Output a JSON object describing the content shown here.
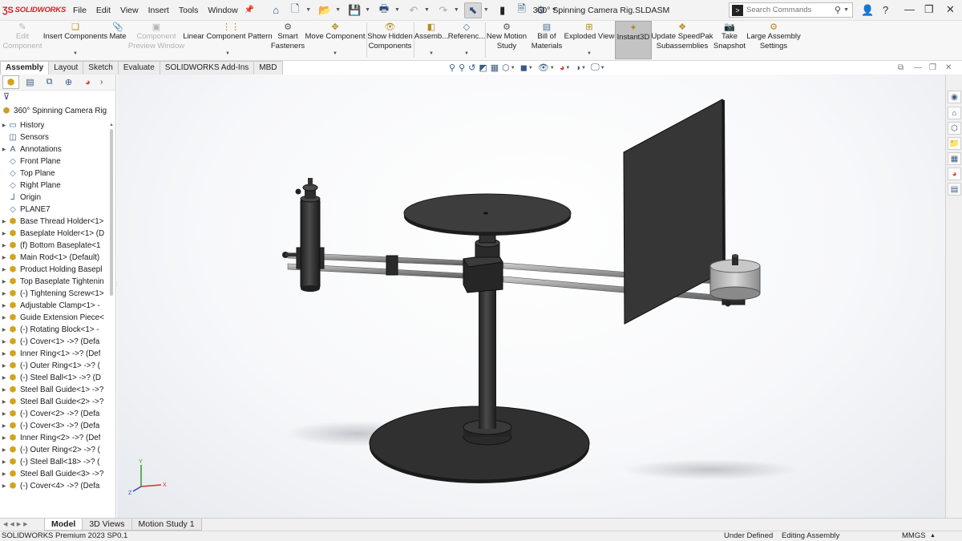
{
  "app": {
    "brand": "SOLIDWORKS",
    "menus": [
      "File",
      "Edit",
      "View",
      "Insert",
      "Tools",
      "Window"
    ],
    "document_title": "360° Spinning Camera Rig.SLDASM",
    "search_placeholder": "Search Commands"
  },
  "command_manager": {
    "commands": [
      {
        "label1": "Edit",
        "label2": "Component",
        "icon": "edit-component-icon",
        "enabled": false
      },
      {
        "label1": "Insert Components",
        "label2": "",
        "icon": "insert-components-icon",
        "enabled": true
      },
      {
        "label1": "Mate",
        "label2": "",
        "icon": "mate-icon",
        "enabled": true
      },
      {
        "label1": "Component",
        "label2": "Preview Window",
        "icon": "component-preview-icon",
        "enabled": false
      },
      {
        "label1": "Linear Component Pattern",
        "label2": "",
        "icon": "linear-pattern-icon",
        "enabled": true
      },
      {
        "label1": "Smart",
        "label2": "Fasteners",
        "icon": "smart-fasteners-icon",
        "enabled": true
      },
      {
        "label1": "Move Component",
        "label2": "",
        "icon": "move-component-icon",
        "enabled": true
      },
      {
        "label1": "Show Hidden",
        "label2": "Components",
        "icon": "show-hidden-icon",
        "enabled": true
      },
      {
        "label1": "Assemb...",
        "label2": "",
        "icon": "assembly-features-icon",
        "enabled": true
      },
      {
        "label1": "Referenc...",
        "label2": "",
        "icon": "reference-geometry-icon",
        "enabled": true
      },
      {
        "label1": "New Motion",
        "label2": "Study",
        "icon": "motion-study-icon",
        "enabled": true
      },
      {
        "label1": "Bill of",
        "label2": "Materials",
        "icon": "bom-icon",
        "enabled": true
      },
      {
        "label1": "Exploded View",
        "label2": "",
        "icon": "exploded-view-icon",
        "enabled": true
      },
      {
        "label1": "Instant3D",
        "label2": "",
        "icon": "instant3d-icon",
        "enabled": true
      },
      {
        "label1": "Update SpeedPak",
        "label2": "Subassemblies",
        "icon": "speedpak-icon",
        "enabled": true
      },
      {
        "label1": "Take",
        "label2": "Snapshot",
        "icon": "snapshot-icon",
        "enabled": true
      },
      {
        "label1": "Large Assembly",
        "label2": "Settings",
        "icon": "large-assembly-icon",
        "enabled": true
      }
    ]
  },
  "tabs": [
    "Assembly",
    "Layout",
    "Sketch",
    "Evaluate",
    "SOLIDWORKS Add-Ins",
    "MBD"
  ],
  "active_tab": "Assembly",
  "feature_tree": {
    "root": "360° Spinning Camera Rig (",
    "items": [
      {
        "label": "History",
        "icon": "folder-icon",
        "expandable": true
      },
      {
        "label": "Sensors",
        "icon": "sensor-icon",
        "expandable": false
      },
      {
        "label": "Annotations",
        "icon": "annotation-icon",
        "expandable": true
      },
      {
        "label": "Front Plane",
        "icon": "plane-icon",
        "expandable": false
      },
      {
        "label": "Top Plane",
        "icon": "plane-icon",
        "expandable": false
      },
      {
        "label": "Right Plane",
        "icon": "plane-icon",
        "expandable": false
      },
      {
        "label": "Origin",
        "icon": "origin-icon",
        "expandable": false
      },
      {
        "label": "PLANE7",
        "icon": "plane-icon",
        "expandable": false
      },
      {
        "label": "Base Thread Holder<1>",
        "icon": "component-icon",
        "expandable": true
      },
      {
        "label": "Baseplate Holder<1> (D",
        "icon": "component-icon",
        "expandable": true
      },
      {
        "label": "(f) Bottom Baseplate<1",
        "icon": "component-icon",
        "expandable": true
      },
      {
        "label": "Main Rod<1> (Default)",
        "icon": "component-icon",
        "expandable": true
      },
      {
        "label": "Product Holding Basepl",
        "icon": "component-icon",
        "expandable": true
      },
      {
        "label": "Top Baseplate Tightenin",
        "icon": "component-icon",
        "expandable": true
      },
      {
        "label": "(-) Tightening Screw<1>",
        "icon": "component-icon",
        "expandable": true
      },
      {
        "label": "Adjustable Clamp<1> -",
        "icon": "component-icon",
        "expandable": true
      },
      {
        "label": "Guide Extension Piece<",
        "icon": "component-icon",
        "expandable": true
      },
      {
        "label": "(-) Rotating Block<1> -",
        "icon": "component-icon",
        "expandable": true
      },
      {
        "label": "(-) Cover<1> ->? (Defa",
        "icon": "component-icon",
        "expandable": true
      },
      {
        "label": "Inner Ring<1> ->? (Def",
        "icon": "component-icon",
        "expandable": true
      },
      {
        "label": "(-) Outer Ring<1> ->? (",
        "icon": "component-icon",
        "expandable": true
      },
      {
        "label": "(-) Steel Ball<1> ->? (D",
        "icon": "component-icon",
        "expandable": true
      },
      {
        "label": "Steel Ball Guide<1> ->?",
        "icon": "component-icon",
        "expandable": true
      },
      {
        "label": "Steel Ball Guide<2> ->?",
        "icon": "component-icon",
        "expandable": true
      },
      {
        "label": "(-) Cover<2> ->? (Defa",
        "icon": "component-icon",
        "expandable": true
      },
      {
        "label": "(-) Cover<3> ->? (Defa",
        "icon": "component-icon",
        "expandable": true
      },
      {
        "label": "Inner Ring<2> ->? (Def",
        "icon": "component-icon",
        "expandable": true
      },
      {
        "label": "(-) Outer Ring<2> ->? (",
        "icon": "component-icon",
        "expandable": true
      },
      {
        "label": "(-) Steel Ball<18> ->? (",
        "icon": "component-icon",
        "expandable": true
      },
      {
        "label": "Steel Ball Guide<3> ->?",
        "icon": "component-icon",
        "expandable": true
      },
      {
        "label": "(-) Cover<4> ->? (Defa",
        "icon": "component-icon",
        "expandable": true
      }
    ]
  },
  "bottom_tabs": [
    "Model",
    "3D Views",
    "Motion Study 1"
  ],
  "active_bottom_tab": "Model",
  "status": {
    "product": "SOLIDWORKS Premium 2023 SP0.1",
    "definition": "Under Defined",
    "mode": "Editing Assembly",
    "units": "MMGS"
  },
  "colors": {
    "accent": "#d81f26",
    "part": "#3a3a3a",
    "rod": "#9a9a9a",
    "motor": "#bdbdbd"
  }
}
